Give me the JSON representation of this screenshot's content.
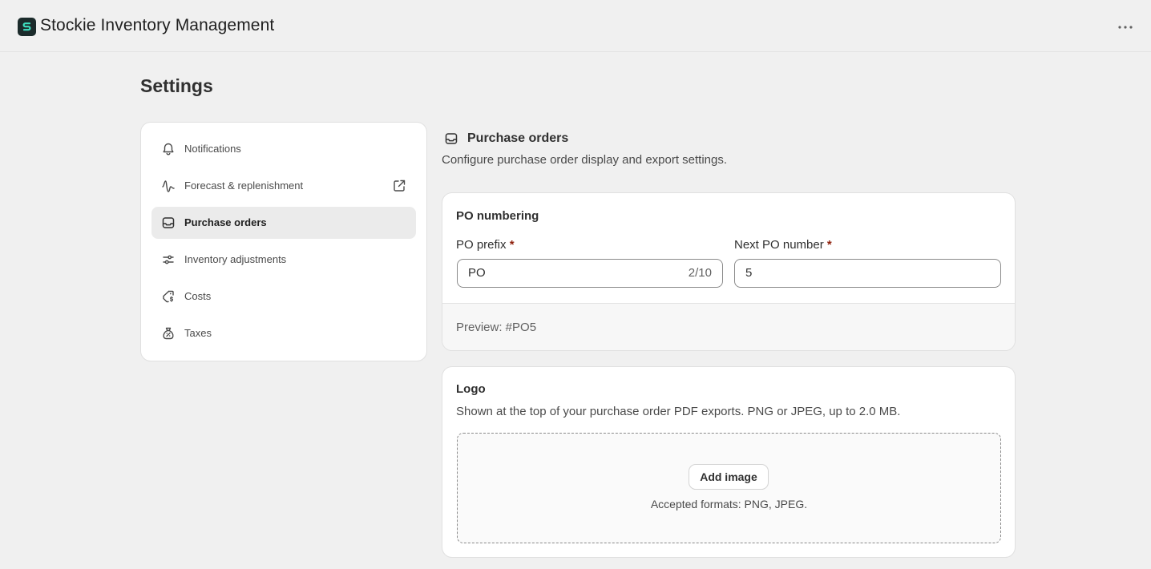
{
  "app": {
    "title": "Stockie Inventory Management",
    "logo_letter": "S",
    "logo_color": "#1b2b2b",
    "logo_accent": "#3fe0c0"
  },
  "page": {
    "title": "Settings"
  },
  "sidebar": {
    "items": [
      {
        "label": "Notifications",
        "icon": "bell-icon",
        "active": false
      },
      {
        "label": "Forecast & replenishment",
        "icon": "trend-line-icon",
        "active": false,
        "external": true
      },
      {
        "label": "Purchase orders",
        "icon": "inbox-tray-icon",
        "active": true
      },
      {
        "label": "Inventory adjustments",
        "icon": "sliders-icon",
        "active": false
      },
      {
        "label": "Costs",
        "icon": "cost-tag-icon",
        "active": false
      },
      {
        "label": "Taxes",
        "icon": "tax-bag-icon",
        "active": false
      }
    ]
  },
  "section": {
    "title": "Purchase orders",
    "icon": "inbox-tray-icon",
    "description": "Configure purchase order display and export settings."
  },
  "po_numbering": {
    "title": "PO numbering",
    "prefix_label": "PO prefix",
    "prefix_value": "PO",
    "prefix_count": "2/10",
    "next_label": "Next PO number",
    "next_value": "5",
    "required_mark": "*",
    "preview": "Preview: #PO5"
  },
  "logo": {
    "title": "Logo",
    "description": "Shown at the top of your purchase order PDF exports. PNG or JPEG, up to 2.0 MB.",
    "add_button": "Add image",
    "accepted": "Accepted formats: PNG, JPEG."
  }
}
